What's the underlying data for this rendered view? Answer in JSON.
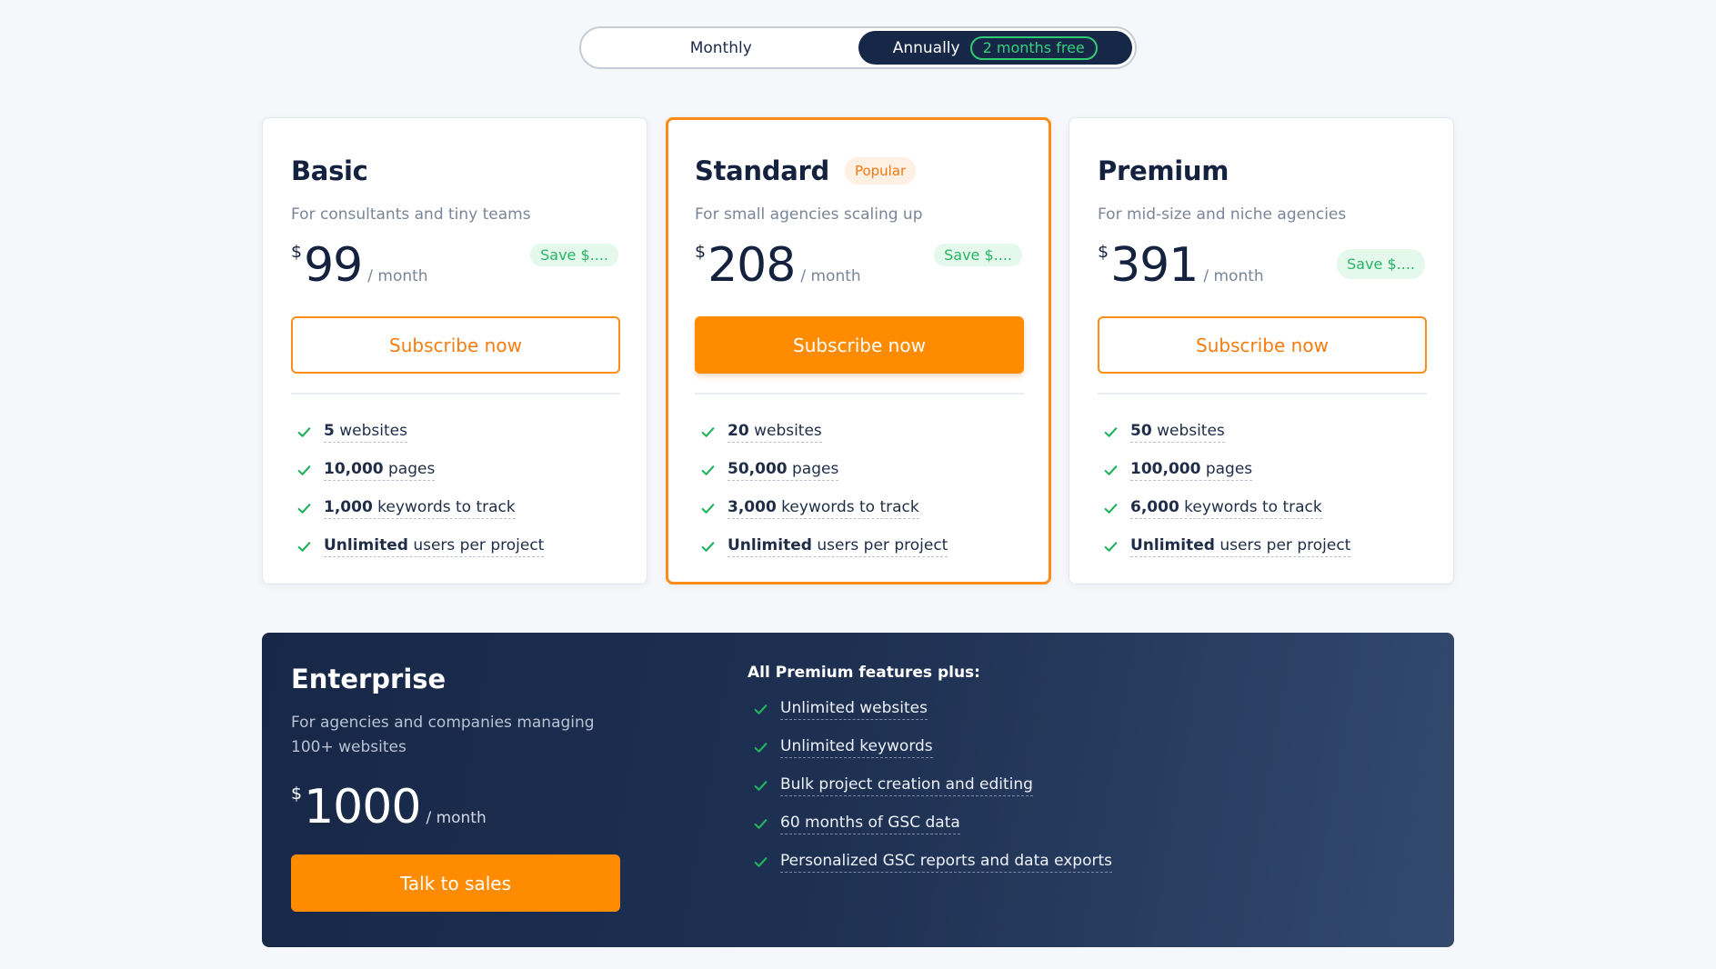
{
  "billing_toggle": {
    "monthly_label": "Monthly",
    "annually_label": "Annually",
    "annually_badge": "2 months free",
    "selected": "Annually"
  },
  "plans": [
    {
      "name": "Basic",
      "description": "For consultants and tiny teams",
      "currency": "$",
      "price": "99",
      "period": "/ month",
      "save_label": "Save $....",
      "cta_label": "Subscribe now",
      "features": [
        {
          "strong": "5",
          "text": " websites"
        },
        {
          "strong": "10,000",
          "text": " pages"
        },
        {
          "strong": "1,000",
          "text": " keywords to track"
        },
        {
          "strong": "Unlimited",
          "text": " users per project"
        }
      ]
    },
    {
      "name": "Standard",
      "badge": "Popular",
      "description": "For small agencies scaling up",
      "currency": "$",
      "price": "208",
      "period": "/ month",
      "save_label": "Save $....",
      "cta_label": "Subscribe now",
      "features": [
        {
          "strong": "20",
          "text": " websites"
        },
        {
          "strong": "50,000",
          "text": " pages"
        },
        {
          "strong": "3,000",
          "text": " keywords to track"
        },
        {
          "strong": "Unlimited",
          "text": " users per project"
        }
      ]
    },
    {
      "name": "Premium",
      "description": "For mid-size and niche agencies",
      "currency": "$",
      "price": "391",
      "period": "/ month",
      "save_label": "Save $....",
      "cta_label": "Subscribe now",
      "features": [
        {
          "strong": "50",
          "text": " websites"
        },
        {
          "strong": "100,000",
          "text": " pages"
        },
        {
          "strong": "6,000",
          "text": " keywords to track"
        },
        {
          "strong": "Unlimited",
          "text": " users per project"
        }
      ]
    }
  ],
  "enterprise": {
    "name": "Enterprise",
    "description": "For agencies and companies managing 100+ websites",
    "currency": "$",
    "price": "1000",
    "period": "/ month",
    "cta_label": "Talk to sales",
    "features_heading": "All Premium features plus:",
    "features": [
      "Unlimited websites",
      "Unlimited keywords",
      "Bulk project creation and editing",
      "60 months of GSC data",
      "Personalized GSC reports and data exports"
    ]
  },
  "colors": {
    "accent": "#ff8c00",
    "check": "#22b35e",
    "navy": "#172747"
  },
  "icons": {
    "check": "check-icon"
  }
}
